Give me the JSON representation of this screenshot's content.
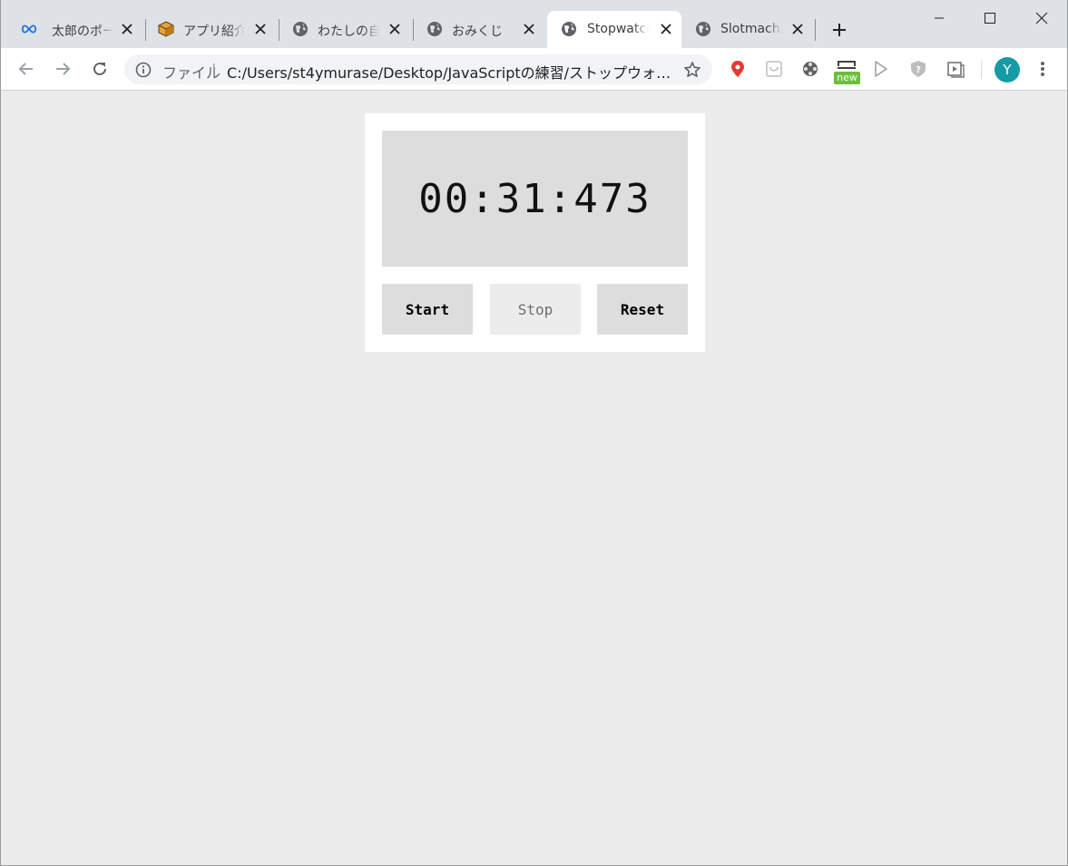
{
  "browser": {
    "tabs": [
      {
        "title": "太郎のポートフォリオ",
        "icon": "infinity-icon",
        "active": false
      },
      {
        "title": "アプリ紹介サイト",
        "icon": "box-icon",
        "active": false
      },
      {
        "title": "わたしの自己紹介",
        "icon": "globe-icon",
        "active": false
      },
      {
        "title": "おみくじ",
        "icon": "globe-icon",
        "active": false
      },
      {
        "title": "Stopwatch",
        "icon": "globe-icon",
        "active": true
      },
      {
        "title": "Slotmachine",
        "icon": "globe-icon",
        "active": false
      }
    ],
    "omnibox": {
      "scheme_label": "ファイル",
      "divider": "|",
      "url": "C:/Users/st4ymurase/Desktop/JavaScriptの練習/ストップウォッチ…"
    },
    "extensions": {
      "new_badge": "new"
    },
    "profile_initial": "Y",
    "accent_color": "#159ba6"
  },
  "stopwatch": {
    "time": "00:31:473",
    "buttons": {
      "start": "Start",
      "stop": "Stop",
      "reset": "Reset"
    },
    "stop_disabled": true
  }
}
